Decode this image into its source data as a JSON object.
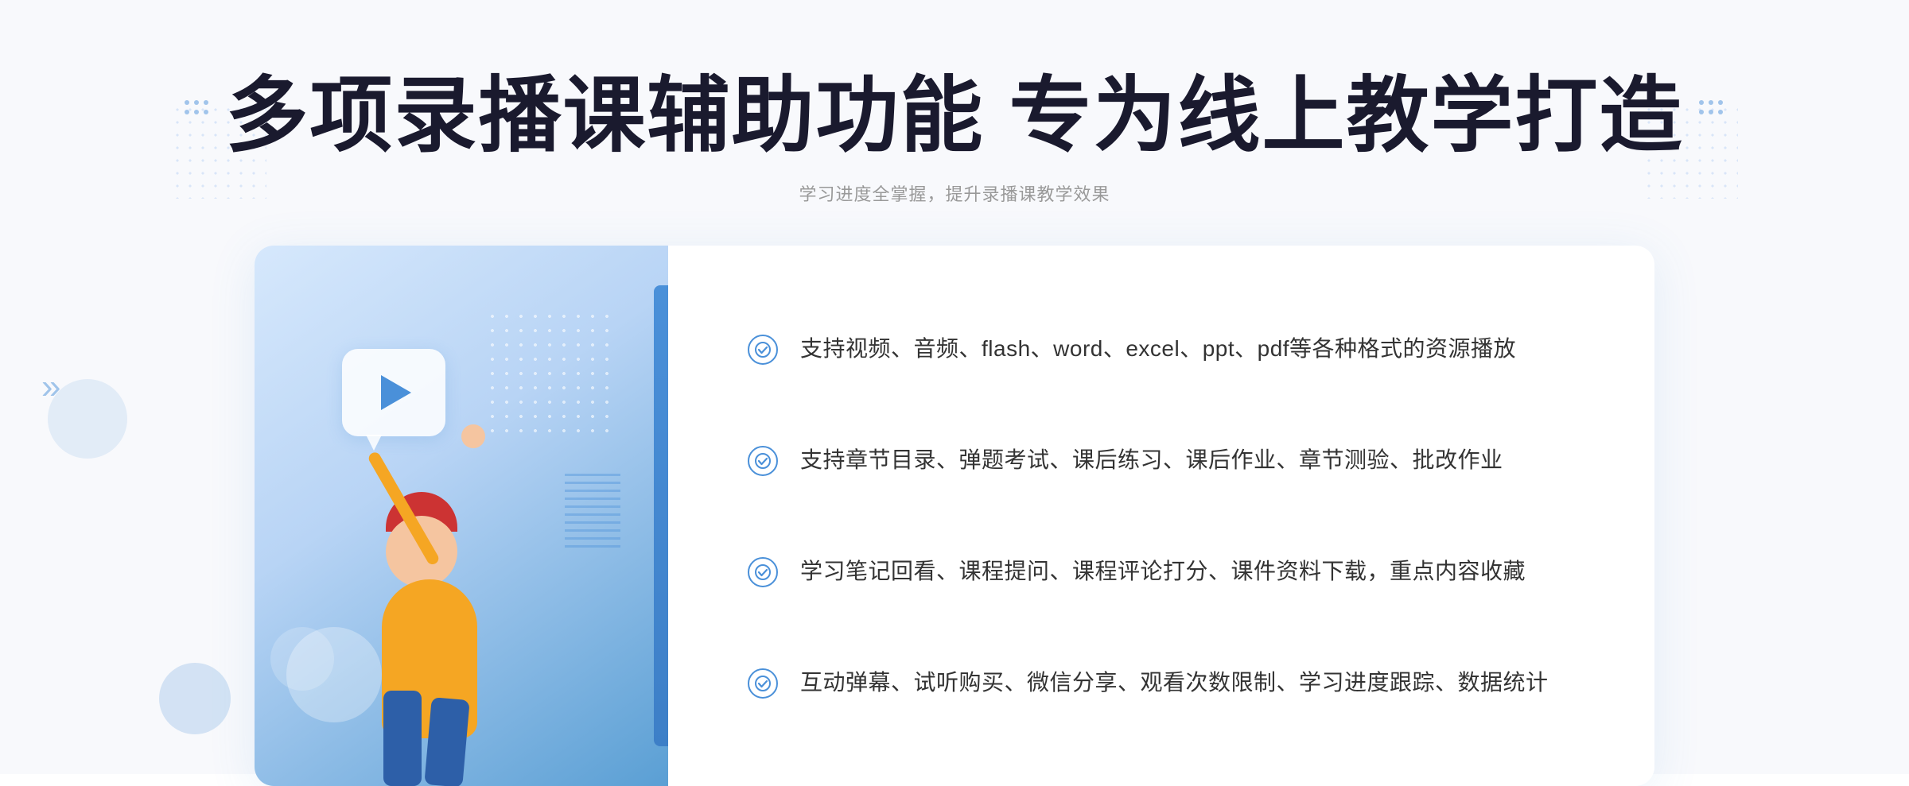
{
  "header": {
    "title": "多项录播课辅助功能 专为线上教学打造",
    "subtitle": "学习进度全掌握，提升录播课教学效果"
  },
  "features": [
    {
      "id": "feature-1",
      "text": "支持视频、音频、flash、word、excel、ppt、pdf等各种格式的资源播放"
    },
    {
      "id": "feature-2",
      "text": "支持章节目录、弹题考试、课后练习、课后作业、章节测验、批改作业"
    },
    {
      "id": "feature-3",
      "text": "学习笔记回看、课程提问、课程评论打分、课件资料下载，重点内容收藏"
    },
    {
      "id": "feature-4",
      "text": "互动弹幕、试听购买、微信分享、观看次数限制、学习进度跟踪、数据统计"
    }
  ],
  "deco": {
    "chevron": "»",
    "check_symbol": "✓"
  }
}
